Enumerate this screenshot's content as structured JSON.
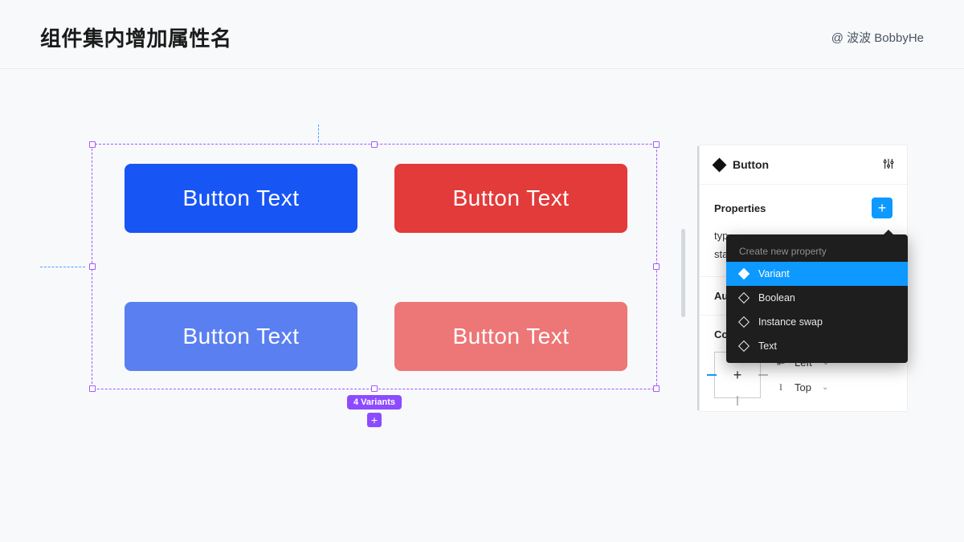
{
  "header": {
    "title": "组件集内增加属性名",
    "author": "@ 波波 BobbyHe"
  },
  "canvas": {
    "variants_label": "4 Variants",
    "buttons": [
      "Button Text",
      "Button Text",
      "Button Text",
      "Button Text"
    ]
  },
  "inspector": {
    "component_name": "Button",
    "properties_label": "Properties",
    "prop_rows": [
      "typ",
      "sta"
    ],
    "auto_layout_label": "Au",
    "constraints_label": "Co",
    "constraint_h": "Left",
    "constraint_v": "Top"
  },
  "menu": {
    "header": "Create new property",
    "items": [
      "Variant",
      "Boolean",
      "Instance swap",
      "Text"
    ],
    "highlight_index": 0
  }
}
